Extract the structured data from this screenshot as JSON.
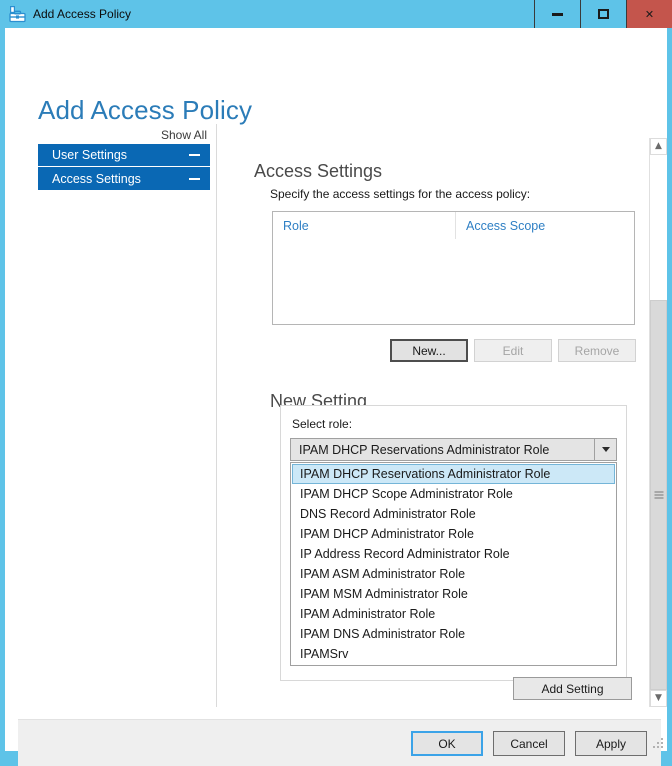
{
  "window": {
    "title": "Add Access Policy",
    "icon": "policy-toolbox-icon",
    "controls": {
      "minimize": "minimize-icon",
      "maximize": "maximize-icon",
      "close": "close-icon"
    }
  },
  "page": {
    "title": "Add Access Policy"
  },
  "sidebar": {
    "show_all": "Show All",
    "items": [
      {
        "label": "User Settings",
        "toggle": "collapse-icon"
      },
      {
        "label": "Access Settings",
        "toggle": "collapse-icon"
      }
    ]
  },
  "main": {
    "heading": "Access Settings",
    "instruction": "Specify the access settings for the access policy:",
    "table": {
      "columns": [
        "Role",
        "Access Scope"
      ],
      "rows": []
    },
    "table_actions": [
      {
        "label": "New...",
        "state": "focused"
      },
      {
        "label": "Edit",
        "state": "disabled"
      },
      {
        "label": "Remove",
        "state": "disabled"
      }
    ],
    "new_setting": {
      "heading": "New Setting",
      "field_label": "Select role:",
      "selected_role": "IPAM DHCP Reservations Administrator Role",
      "dropdown_open": true,
      "options": [
        "IPAM DHCP Reservations Administrator Role",
        "IPAM DHCP Scope Administrator Role",
        "DNS Record Administrator Role",
        "IPAM DHCP Administrator Role",
        "IP Address Record Administrator Role",
        "IPAM ASM Administrator Role",
        "IPAM MSM Administrator Role",
        "IPAM Administrator Role",
        "IPAM DNS Administrator Role",
        "IPAMSrv"
      ],
      "add_button": "Add Setting"
    }
  },
  "footer": {
    "buttons": [
      {
        "label": "OK",
        "state": "default"
      },
      {
        "label": "Cancel",
        "state": "normal"
      },
      {
        "label": "Apply",
        "state": "normal"
      }
    ]
  },
  "colors": {
    "titlebar": "#5ec3e8",
    "close": "#c4554c",
    "nav_item": "#0a68b4",
    "accent_heading": "#2b7cb8",
    "column_header": "#2e7fc4",
    "selection": "#cce8f7",
    "focus_border": "#3ba3e8"
  }
}
